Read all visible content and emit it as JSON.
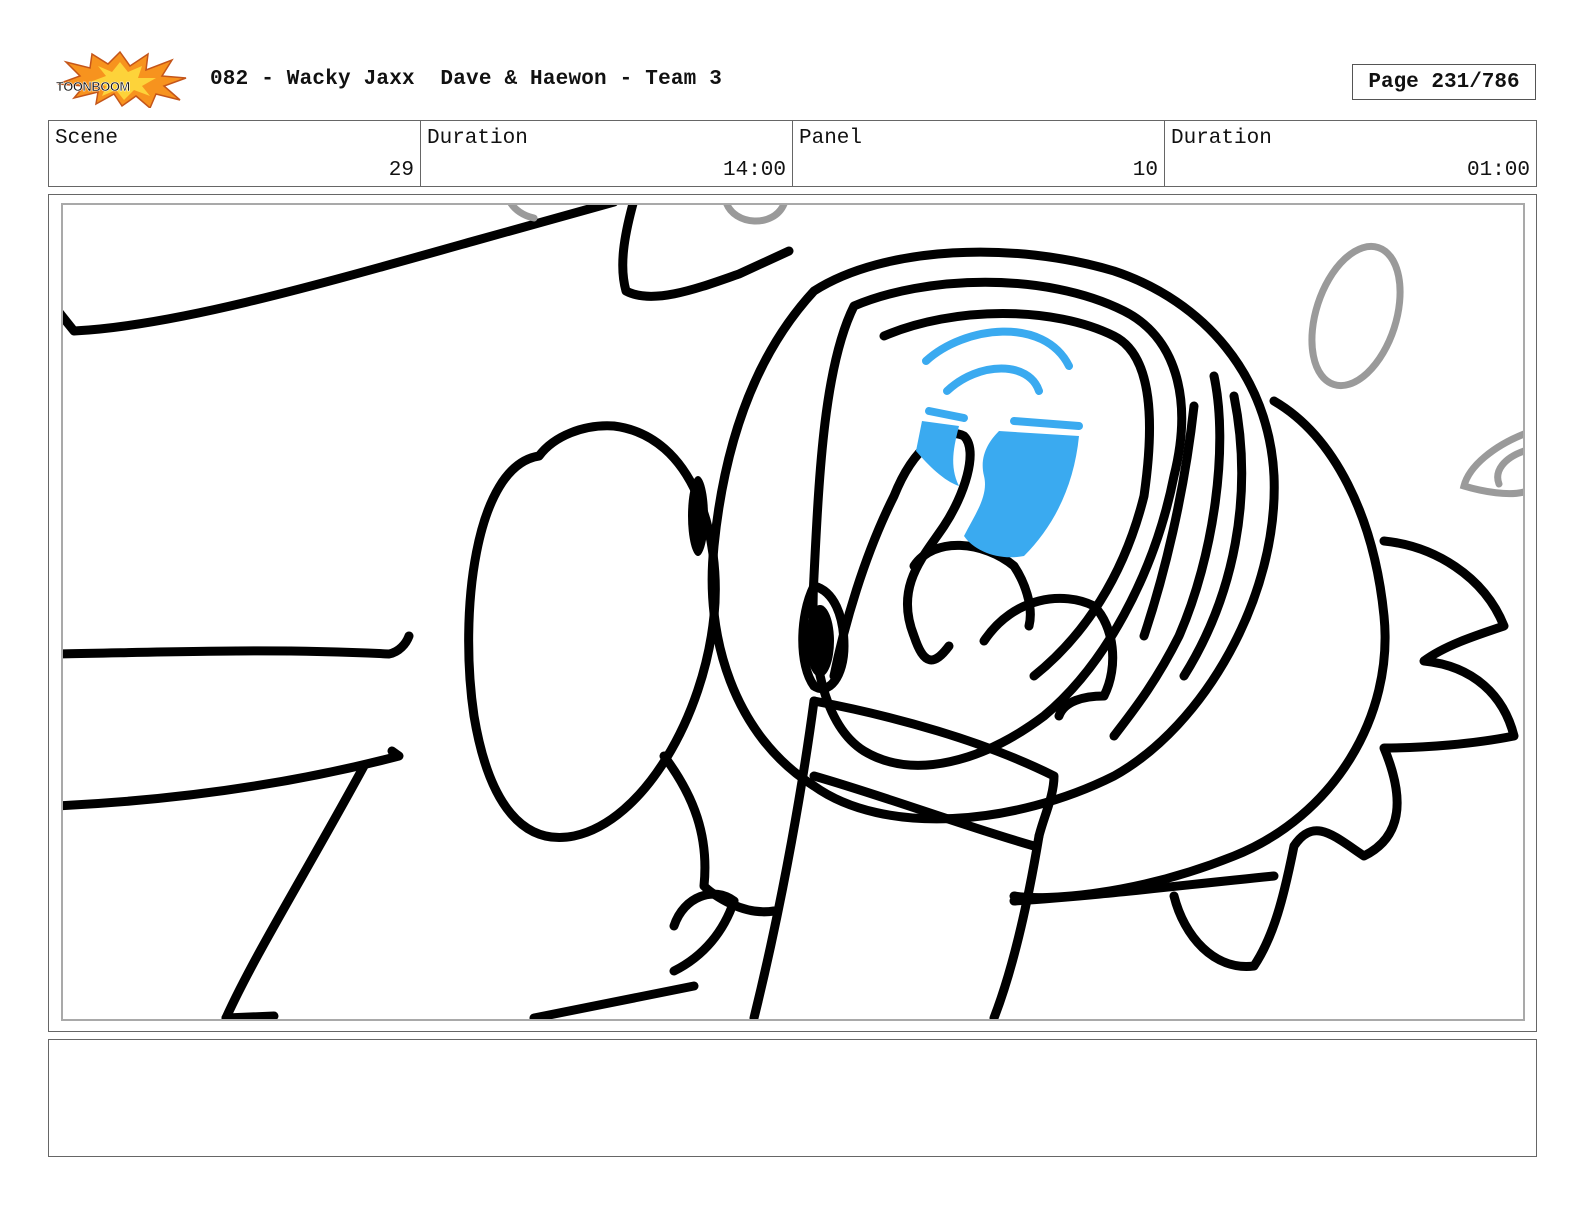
{
  "header": {
    "logo_text": "TOONBOOM",
    "title": "082 - Wacky Jaxx  Dave & Haewon - Team 3",
    "page_label": "Page 231/786"
  },
  "info": {
    "scene_label": "Scene",
    "scene_value": "29",
    "scene_duration_label": "Duration",
    "scene_duration_value": "14:00",
    "panel_label": "Panel",
    "panel_value": "10",
    "panel_duration_label": "Duration",
    "panel_duration_value": "01:00"
  },
  "notes": {
    "text": ""
  },
  "colors": {
    "ink": "#000000",
    "accent_blue": "#3aaaf0",
    "guide_gray": "#9a9a9a",
    "logo_orange": "#f7931e"
  }
}
